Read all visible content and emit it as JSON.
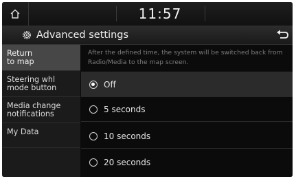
{
  "status": {
    "time": "11:57"
  },
  "header": {
    "title": "Advanced settings"
  },
  "sidebar": {
    "items": [
      {
        "label": "Return\nto map"
      },
      {
        "label": "Steering whl\nmode button"
      },
      {
        "label": "Media change\nnotifications"
      },
      {
        "label": "My Data"
      }
    ]
  },
  "main": {
    "description": "After the defined time, the system will be switched back from Radio/Media to the map screen.",
    "options": [
      {
        "label": "Off"
      },
      {
        "label": "5 seconds"
      },
      {
        "label": "10 seconds"
      },
      {
        "label": "20 seconds"
      }
    ],
    "selected_option": "Off"
  },
  "icons": {
    "home": "home-icon",
    "settings": "gear-icon",
    "back": "back-arrow-icon"
  }
}
